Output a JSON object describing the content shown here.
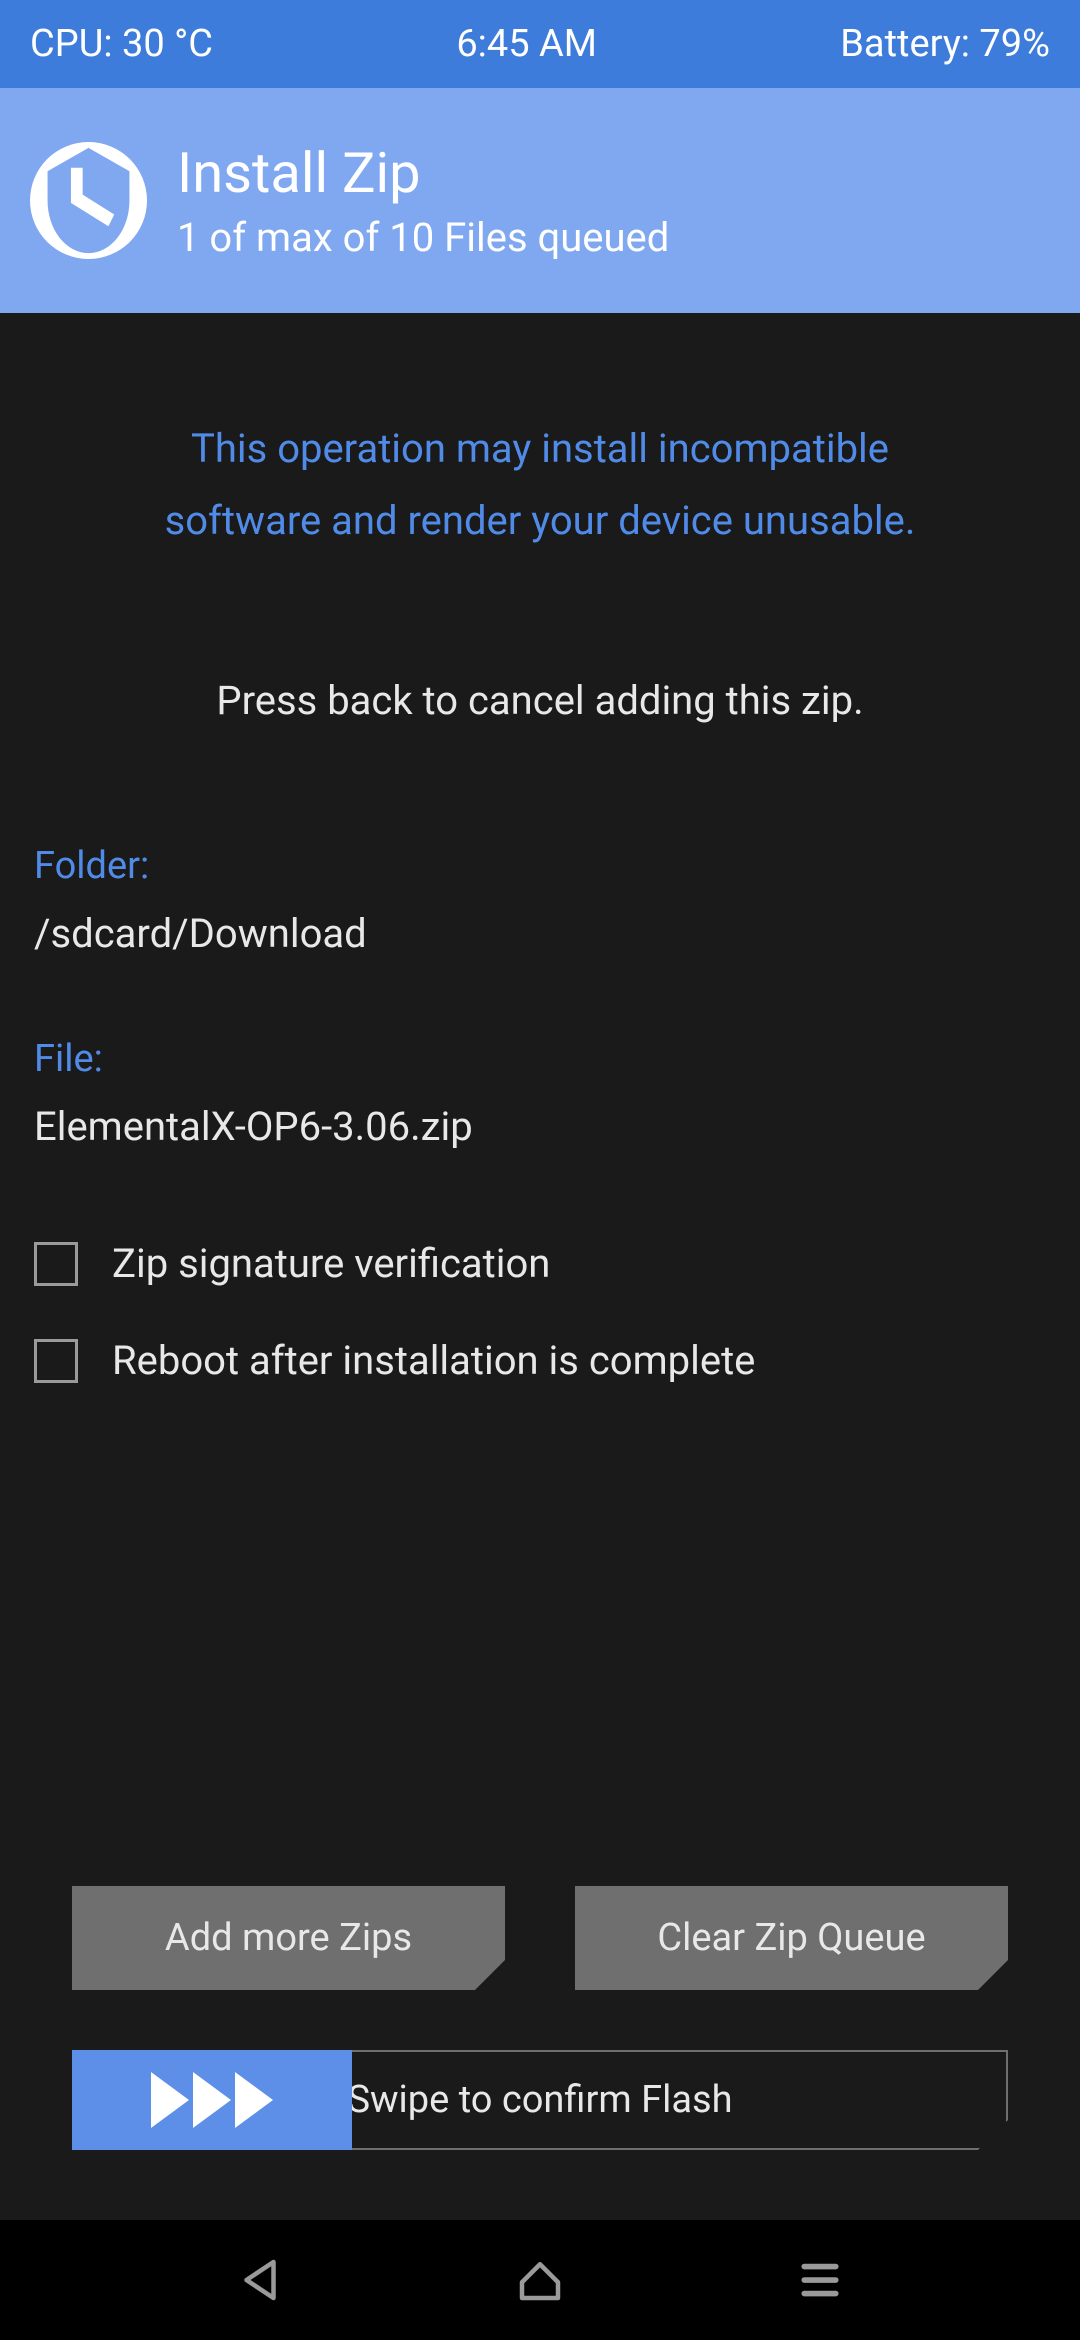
{
  "statusbar": {
    "cpu": "CPU: 30 °C",
    "time": "6:45 AM",
    "battery": "Battery: 79%"
  },
  "header": {
    "title": "Install Zip",
    "subtitle": "1 of max of 10 Files queued"
  },
  "main": {
    "warning_line1": "This operation may install incompatible",
    "warning_line2": "software and render your device unusable.",
    "instruction": "Press back to cancel adding this zip.",
    "folder_label": "Folder:",
    "folder_value": "/sdcard/Download",
    "file_label": "File:",
    "file_value": "ElementalX-OP6-3.06.zip",
    "checkbox1": "Zip signature verification",
    "checkbox2": "Reboot after installation is complete"
  },
  "buttons": {
    "add": "Add more Zips",
    "clear": "Clear Zip Queue"
  },
  "swipe": {
    "label": "Swipe to confirm Flash"
  }
}
